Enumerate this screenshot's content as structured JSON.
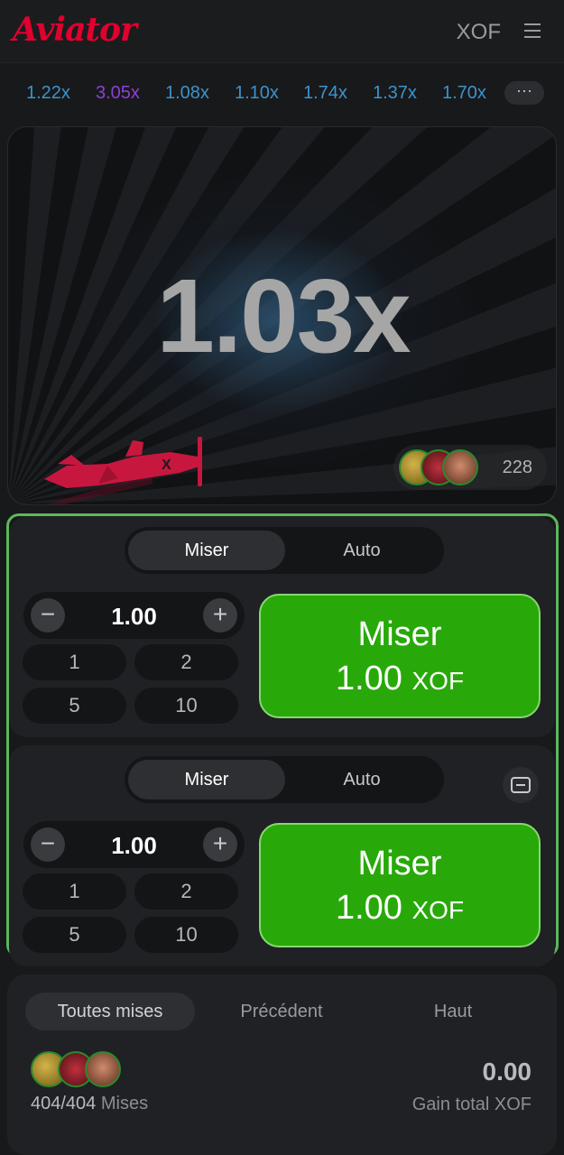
{
  "header": {
    "logo": "Aviator",
    "currency": "XOF",
    "menu_icon": "hamburger-menu-icon"
  },
  "history": {
    "items": [
      {
        "value": "1.22x",
        "color": "#3d93c9"
      },
      {
        "value": "3.05x",
        "color": "#8f3fd6"
      },
      {
        "value": "1.08x",
        "color": "#3d93c9"
      },
      {
        "value": "1.10x",
        "color": "#3d93c9"
      },
      {
        "value": "1.74x",
        "color": "#3d93c9"
      },
      {
        "value": "1.37x",
        "color": "#3d93c9"
      },
      {
        "value": "1.70x",
        "color": "#3d93c9"
      }
    ],
    "more_label": "···"
  },
  "game": {
    "multiplier": "1.03x",
    "players_count": "228",
    "plane_color": "#c8173f"
  },
  "bet_panels": [
    {
      "tabs": [
        "Miser",
        "Auto"
      ],
      "active_tab": "Miser",
      "amount": "1.00",
      "quick_amounts": [
        "1",
        "2",
        "5",
        "10"
      ],
      "button_title": "Miser",
      "button_amount": "1.00",
      "button_currency": "XOF"
    },
    {
      "tabs": [
        "Miser",
        "Auto"
      ],
      "active_tab": "Miser",
      "amount": "1.00",
      "quick_amounts": [
        "1",
        "2",
        "5",
        "10"
      ],
      "button_title": "Miser",
      "button_amount": "1.00",
      "button_currency": "XOF"
    }
  ],
  "bottom": {
    "tabs": [
      "Toutes mises",
      "Précédent",
      "Haut"
    ],
    "active_tab": "Toutes mises",
    "bets_count": "404/404",
    "bets_label": "Mises",
    "total_win": "0.00",
    "total_win_label": "Gain total XOF"
  },
  "colors": {
    "accent_red": "#e1002e",
    "bet_green": "#28a909",
    "frame_green": "#5cb85c"
  }
}
